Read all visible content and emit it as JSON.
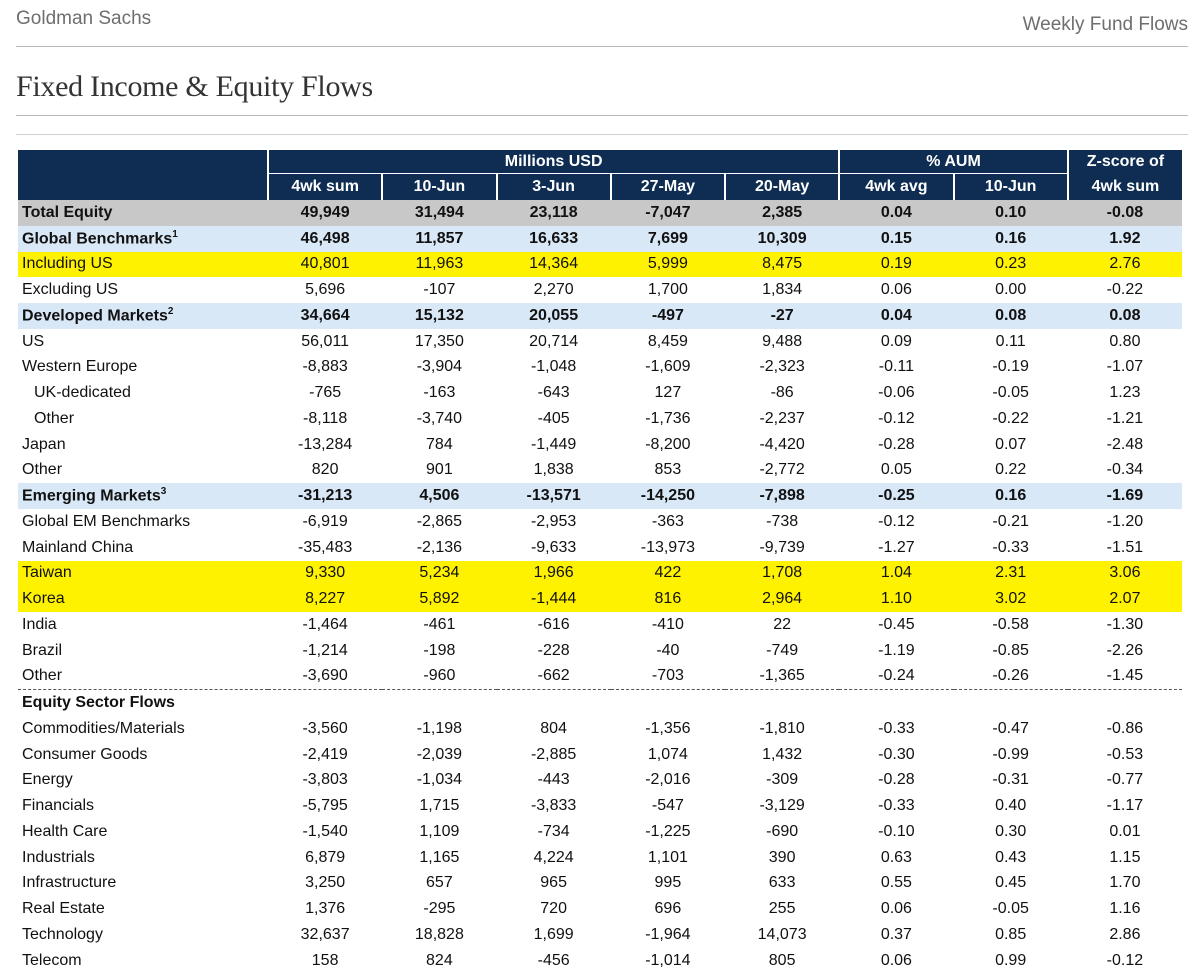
{
  "header": {
    "brand": "Goldman Sachs",
    "report": "Weekly Fund Flows"
  },
  "page_title": "Fixed Income & Equity Flows",
  "table": {
    "group_headers": {
      "millions": "Millions USD",
      "aum": "% AUM",
      "zscore": "Z-score of"
    },
    "columns": [
      "4wk sum",
      "10-Jun",
      "3-Jun",
      "27-May",
      "20-May",
      "4wk avg",
      "10-Jun",
      "4wk sum"
    ],
    "rows": [
      {
        "label": "Total Equity",
        "sup": "",
        "style": "total",
        "values": [
          "49,949",
          "31,494",
          "23,118",
          "-7,047",
          "2,385",
          "0.04",
          "0.10",
          "-0.08"
        ]
      },
      {
        "label": "Global Benchmarks",
        "sup": "1",
        "style": "bench",
        "values": [
          "46,498",
          "11,857",
          "16,633",
          "7,699",
          "10,309",
          "0.15",
          "0.16",
          "1.92"
        ]
      },
      {
        "label": "Including US",
        "sup": "",
        "style": "hl",
        "values": [
          "40,801",
          "11,963",
          "14,364",
          "5,999",
          "8,475",
          "0.19",
          "0.23",
          "2.76"
        ]
      },
      {
        "label": "Excluding US",
        "sup": "",
        "style": "",
        "values": [
          "5,696",
          "-107",
          "2,270",
          "1,700",
          "1,834",
          "0.06",
          "0.00",
          "-0.22"
        ]
      },
      {
        "label": "Developed Markets",
        "sup": "2",
        "style": "bench",
        "values": [
          "34,664",
          "15,132",
          "20,055",
          "-497",
          "-27",
          "0.04",
          "0.08",
          "0.08"
        ]
      },
      {
        "label": "US",
        "sup": "",
        "style": "",
        "values": [
          "56,011",
          "17,350",
          "20,714",
          "8,459",
          "9,488",
          "0.09",
          "0.11",
          "0.80"
        ]
      },
      {
        "label": "Western Europe",
        "sup": "",
        "style": "",
        "values": [
          "-8,883",
          "-3,904",
          "-1,048",
          "-1,609",
          "-2,323",
          "-0.11",
          "-0.19",
          "-1.07"
        ]
      },
      {
        "label": "UK-dedicated",
        "sup": "",
        "style": "indent",
        "values": [
          "-765",
          "-163",
          "-643",
          "127",
          "-86",
          "-0.06",
          "-0.05",
          "1.23"
        ]
      },
      {
        "label": "Other",
        "sup": "",
        "style": "indent",
        "values": [
          "-8,118",
          "-3,740",
          "-405",
          "-1,736",
          "-2,237",
          "-0.12",
          "-0.22",
          "-1.21"
        ]
      },
      {
        "label": "Japan",
        "sup": "",
        "style": "",
        "values": [
          "-13,284",
          "784",
          "-1,449",
          "-8,200",
          "-4,420",
          "-0.28",
          "0.07",
          "-2.48"
        ]
      },
      {
        "label": "Other",
        "sup": "",
        "style": "",
        "values": [
          "820",
          "901",
          "1,838",
          "853",
          "-2,772",
          "0.05",
          "0.22",
          "-0.34"
        ]
      },
      {
        "label": "Emerging Markets",
        "sup": "3",
        "style": "bench",
        "values": [
          "-31,213",
          "4,506",
          "-13,571",
          "-14,250",
          "-7,898",
          "-0.25",
          "0.16",
          "-1.69"
        ]
      },
      {
        "label": "Global EM Benchmarks",
        "sup": "",
        "style": "",
        "values": [
          "-6,919",
          "-2,865",
          "-2,953",
          "-363",
          "-738",
          "-0.12",
          "-0.21",
          "-1.20"
        ]
      },
      {
        "label": "Mainland China",
        "sup": "",
        "style": "",
        "values": [
          "-35,483",
          "-2,136",
          "-9,633",
          "-13,973",
          "-9,739",
          "-1.27",
          "-0.33",
          "-1.51"
        ]
      },
      {
        "label": "Taiwan",
        "sup": "",
        "style": "hl",
        "values": [
          "9,330",
          "5,234",
          "1,966",
          "422",
          "1,708",
          "1.04",
          "2.31",
          "3.06"
        ]
      },
      {
        "label": "Korea",
        "sup": "",
        "style": "hl",
        "values": [
          "8,227",
          "5,892",
          "-1,444",
          "816",
          "2,964",
          "1.10",
          "3.02",
          "2.07"
        ]
      },
      {
        "label": "India",
        "sup": "",
        "style": "",
        "values": [
          "-1,464",
          "-461",
          "-616",
          "-410",
          "22",
          "-0.45",
          "-0.58",
          "-1.30"
        ]
      },
      {
        "label": "Brazil",
        "sup": "",
        "style": "",
        "values": [
          "-1,214",
          "-198",
          "-228",
          "-40",
          "-749",
          "-1.19",
          "-0.85",
          "-2.26"
        ]
      },
      {
        "label": "Other",
        "sup": "",
        "style": "",
        "values": [
          "-3,690",
          "-960",
          "-662",
          "-703",
          "-1,365",
          "-0.24",
          "-0.26",
          "-1.45"
        ]
      },
      {
        "label": "Equity Sector Flows",
        "sup": "",
        "style": "section",
        "values": [
          "",
          "",
          "",
          "",
          "",
          "",
          "",
          ""
        ]
      },
      {
        "label": "Commodities/Materials",
        "sup": "",
        "style": "",
        "values": [
          "-3,560",
          "-1,198",
          "804",
          "-1,356",
          "-1,810",
          "-0.33",
          "-0.47",
          "-0.86"
        ]
      },
      {
        "label": "Consumer Goods",
        "sup": "",
        "style": "",
        "values": [
          "-2,419",
          "-2,039",
          "-2,885",
          "1,074",
          "1,432",
          "-0.30",
          "-0.99",
          "-0.53"
        ]
      },
      {
        "label": "Energy",
        "sup": "",
        "style": "",
        "values": [
          "-3,803",
          "-1,034",
          "-443",
          "-2,016",
          "-309",
          "-0.28",
          "-0.31",
          "-0.77"
        ]
      },
      {
        "label": "Financials",
        "sup": "",
        "style": "",
        "values": [
          "-5,795",
          "1,715",
          "-3,833",
          "-547",
          "-3,129",
          "-0.33",
          "0.40",
          "-1.17"
        ]
      },
      {
        "label": "Health Care",
        "sup": "",
        "style": "",
        "values": [
          "-1,540",
          "1,109",
          "-734",
          "-1,225",
          "-690",
          "-0.10",
          "0.30",
          "0.01"
        ]
      },
      {
        "label": "Industrials",
        "sup": "",
        "style": "",
        "values": [
          "6,879",
          "1,165",
          "4,224",
          "1,101",
          "390",
          "0.63",
          "0.43",
          "1.15"
        ]
      },
      {
        "label": "Infrastructure",
        "sup": "",
        "style": "",
        "values": [
          "3,250",
          "657",
          "965",
          "995",
          "633",
          "0.55",
          "0.45",
          "1.70"
        ]
      },
      {
        "label": "Real Estate",
        "sup": "",
        "style": "",
        "values": [
          "1,376",
          "-295",
          "720",
          "696",
          "255",
          "0.06",
          "-0.05",
          "1.16"
        ]
      },
      {
        "label": "Technology",
        "sup": "",
        "style": "",
        "values": [
          "32,637",
          "18,828",
          "1,699",
          "-1,964",
          "14,073",
          "0.37",
          "0.85",
          "2.86"
        ]
      },
      {
        "label": "Telecom",
        "sup": "",
        "style": "",
        "values": [
          "158",
          "824",
          "-456",
          "-1,014",
          "805",
          "0.06",
          "0.99",
          "-0.12"
        ]
      }
    ]
  },
  "colors": {
    "header_bg": "#0f2d52",
    "highlight": "#fff200",
    "benchmark_bg": "#d9e8f7",
    "total_bg": "#c8c8c8"
  }
}
